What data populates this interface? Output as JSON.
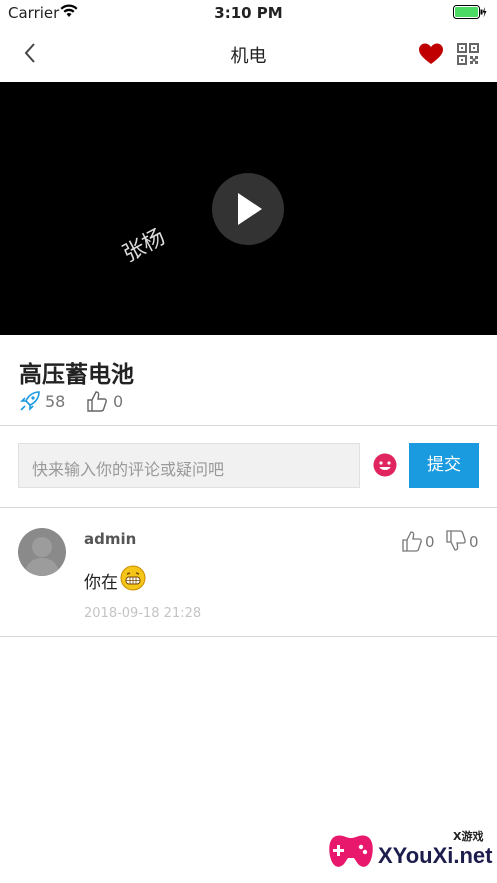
{
  "status_bar": {
    "carrier": "Carrier",
    "time": "3:10 PM"
  },
  "nav": {
    "title": "机电"
  },
  "video": {
    "watermark": "张杨"
  },
  "course": {
    "title": "高压蓄电池",
    "views": "58",
    "likes": "0"
  },
  "comment_form": {
    "placeholder": "快来输入你的评论或疑问吧",
    "submit_label": "提交"
  },
  "comments": [
    {
      "username": "admin",
      "text": "你在",
      "time": "2018-09-18 21:28",
      "likes": "0",
      "dislikes": "0"
    }
  ],
  "brand_watermark": {
    "small": "X游戏",
    "big": "XYouXi.net"
  },
  "colors": {
    "accent": "#1a9be0",
    "heart": "#c00000",
    "emoji_button": "#e0245e"
  }
}
